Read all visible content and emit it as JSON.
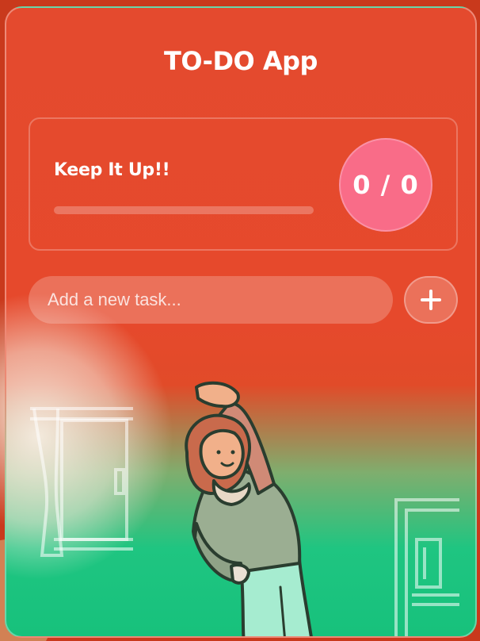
{
  "app": {
    "title": "TO-DO App"
  },
  "progress": {
    "label": "Keep It Up!!",
    "completed": 0,
    "total": 0,
    "counter_text": "0 / 0",
    "fraction": 0
  },
  "task_input": {
    "value": "",
    "placeholder": "Add a new task..."
  },
  "add_button": {
    "icon": "plus-icon"
  },
  "illustration": {
    "subject": "person-stretching-illustration"
  },
  "colors": {
    "accent_red": "#e44a2e",
    "accent_green": "#17c17c",
    "counter_pink": "#f96c88",
    "text": "#ffffff"
  }
}
